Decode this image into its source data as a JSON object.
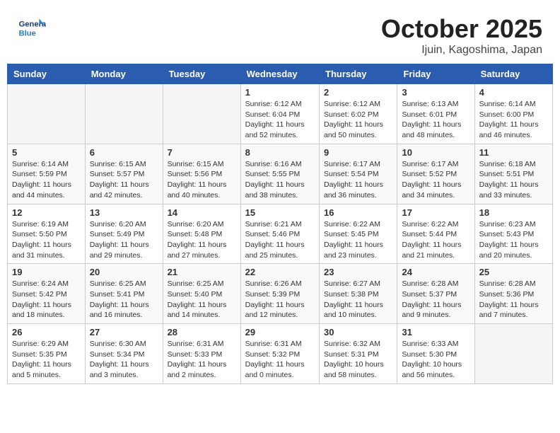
{
  "header": {
    "logo_general": "General",
    "logo_blue": "Blue",
    "month": "October 2025",
    "location": "Ijuin, Kagoshima, Japan"
  },
  "weekdays": [
    "Sunday",
    "Monday",
    "Tuesday",
    "Wednesday",
    "Thursday",
    "Friday",
    "Saturday"
  ],
  "weeks": [
    [
      {
        "day": "",
        "info": ""
      },
      {
        "day": "",
        "info": ""
      },
      {
        "day": "",
        "info": ""
      },
      {
        "day": "1",
        "info": "Sunrise: 6:12 AM\nSunset: 6:04 PM\nDaylight: 11 hours\nand 52 minutes."
      },
      {
        "day": "2",
        "info": "Sunrise: 6:12 AM\nSunset: 6:02 PM\nDaylight: 11 hours\nand 50 minutes."
      },
      {
        "day": "3",
        "info": "Sunrise: 6:13 AM\nSunset: 6:01 PM\nDaylight: 11 hours\nand 48 minutes."
      },
      {
        "day": "4",
        "info": "Sunrise: 6:14 AM\nSunset: 6:00 PM\nDaylight: 11 hours\nand 46 minutes."
      }
    ],
    [
      {
        "day": "5",
        "info": "Sunrise: 6:14 AM\nSunset: 5:59 PM\nDaylight: 11 hours\nand 44 minutes."
      },
      {
        "day": "6",
        "info": "Sunrise: 6:15 AM\nSunset: 5:57 PM\nDaylight: 11 hours\nand 42 minutes."
      },
      {
        "day": "7",
        "info": "Sunrise: 6:15 AM\nSunset: 5:56 PM\nDaylight: 11 hours\nand 40 minutes."
      },
      {
        "day": "8",
        "info": "Sunrise: 6:16 AM\nSunset: 5:55 PM\nDaylight: 11 hours\nand 38 minutes."
      },
      {
        "day": "9",
        "info": "Sunrise: 6:17 AM\nSunset: 5:54 PM\nDaylight: 11 hours\nand 36 minutes."
      },
      {
        "day": "10",
        "info": "Sunrise: 6:17 AM\nSunset: 5:52 PM\nDaylight: 11 hours\nand 34 minutes."
      },
      {
        "day": "11",
        "info": "Sunrise: 6:18 AM\nSunset: 5:51 PM\nDaylight: 11 hours\nand 33 minutes."
      }
    ],
    [
      {
        "day": "12",
        "info": "Sunrise: 6:19 AM\nSunset: 5:50 PM\nDaylight: 11 hours\nand 31 minutes."
      },
      {
        "day": "13",
        "info": "Sunrise: 6:20 AM\nSunset: 5:49 PM\nDaylight: 11 hours\nand 29 minutes."
      },
      {
        "day": "14",
        "info": "Sunrise: 6:20 AM\nSunset: 5:48 PM\nDaylight: 11 hours\nand 27 minutes."
      },
      {
        "day": "15",
        "info": "Sunrise: 6:21 AM\nSunset: 5:46 PM\nDaylight: 11 hours\nand 25 minutes."
      },
      {
        "day": "16",
        "info": "Sunrise: 6:22 AM\nSunset: 5:45 PM\nDaylight: 11 hours\nand 23 minutes."
      },
      {
        "day": "17",
        "info": "Sunrise: 6:22 AM\nSunset: 5:44 PM\nDaylight: 11 hours\nand 21 minutes."
      },
      {
        "day": "18",
        "info": "Sunrise: 6:23 AM\nSunset: 5:43 PM\nDaylight: 11 hours\nand 20 minutes."
      }
    ],
    [
      {
        "day": "19",
        "info": "Sunrise: 6:24 AM\nSunset: 5:42 PM\nDaylight: 11 hours\nand 18 minutes."
      },
      {
        "day": "20",
        "info": "Sunrise: 6:25 AM\nSunset: 5:41 PM\nDaylight: 11 hours\nand 16 minutes."
      },
      {
        "day": "21",
        "info": "Sunrise: 6:25 AM\nSunset: 5:40 PM\nDaylight: 11 hours\nand 14 minutes."
      },
      {
        "day": "22",
        "info": "Sunrise: 6:26 AM\nSunset: 5:39 PM\nDaylight: 11 hours\nand 12 minutes."
      },
      {
        "day": "23",
        "info": "Sunrise: 6:27 AM\nSunset: 5:38 PM\nDaylight: 11 hours\nand 10 minutes."
      },
      {
        "day": "24",
        "info": "Sunrise: 6:28 AM\nSunset: 5:37 PM\nDaylight: 11 hours\nand 9 minutes."
      },
      {
        "day": "25",
        "info": "Sunrise: 6:28 AM\nSunset: 5:36 PM\nDaylight: 11 hours\nand 7 minutes."
      }
    ],
    [
      {
        "day": "26",
        "info": "Sunrise: 6:29 AM\nSunset: 5:35 PM\nDaylight: 11 hours\nand 5 minutes."
      },
      {
        "day": "27",
        "info": "Sunrise: 6:30 AM\nSunset: 5:34 PM\nDaylight: 11 hours\nand 3 minutes."
      },
      {
        "day": "28",
        "info": "Sunrise: 6:31 AM\nSunset: 5:33 PM\nDaylight: 11 hours\nand 2 minutes."
      },
      {
        "day": "29",
        "info": "Sunrise: 6:31 AM\nSunset: 5:32 PM\nDaylight: 11 hours\nand 0 minutes."
      },
      {
        "day": "30",
        "info": "Sunrise: 6:32 AM\nSunset: 5:31 PM\nDaylight: 10 hours\nand 58 minutes."
      },
      {
        "day": "31",
        "info": "Sunrise: 6:33 AM\nSunset: 5:30 PM\nDaylight: 10 hours\nand 56 minutes."
      },
      {
        "day": "",
        "info": ""
      }
    ]
  ]
}
